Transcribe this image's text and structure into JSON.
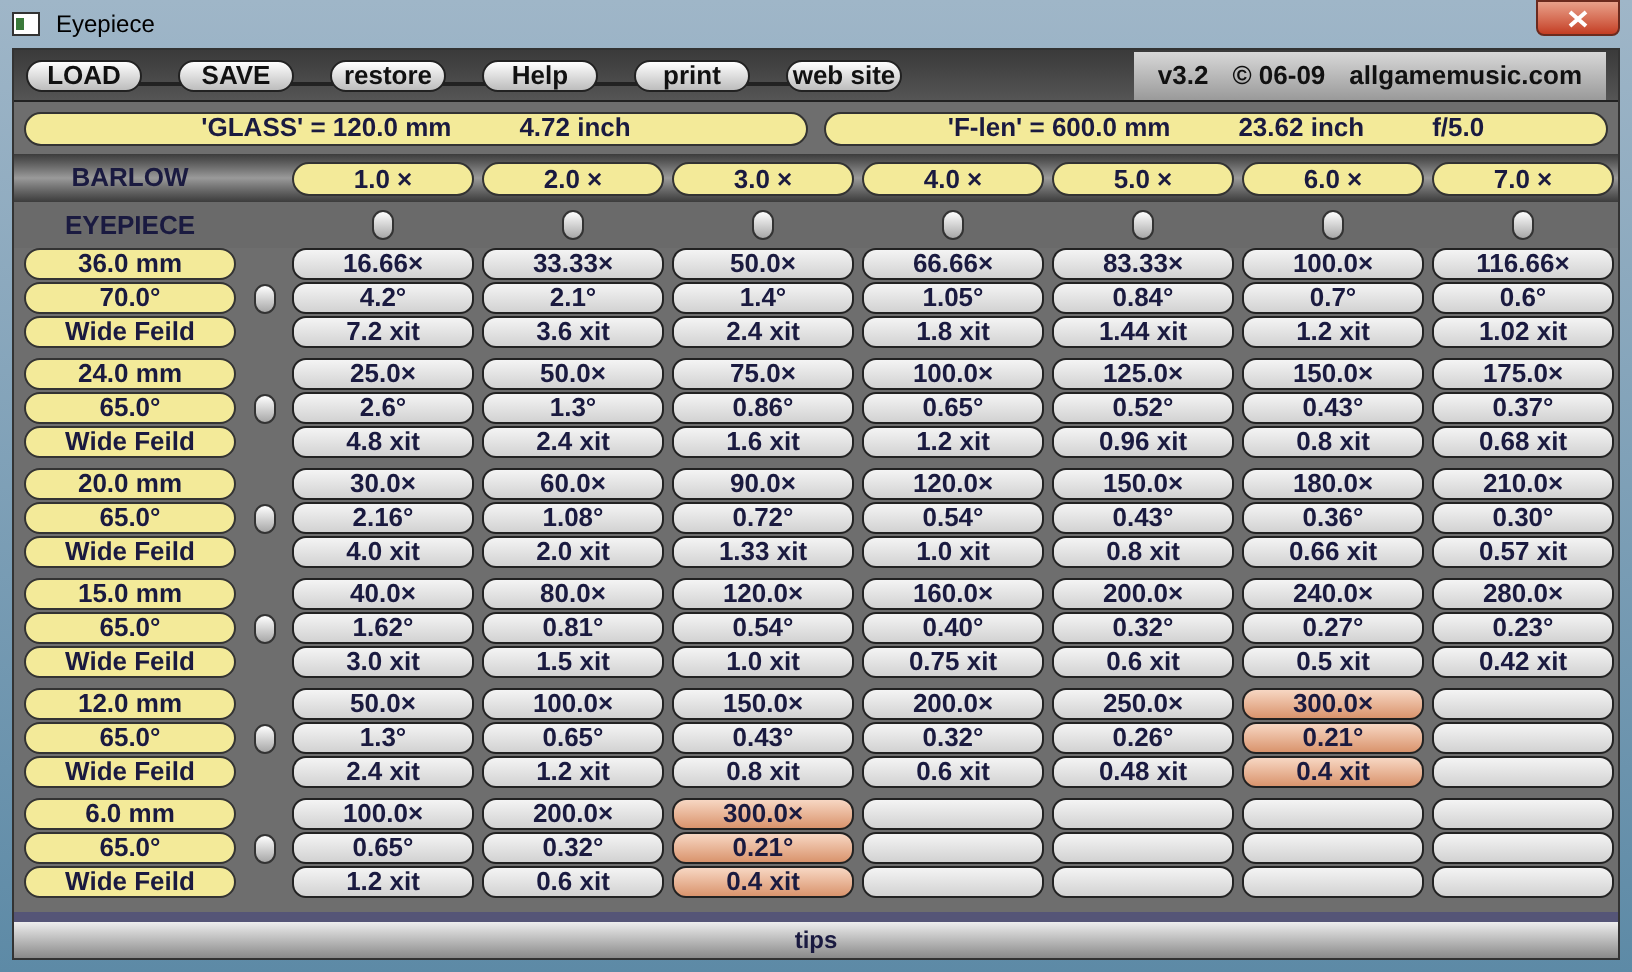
{
  "window": {
    "title": "Eyepiece"
  },
  "toolbar": {
    "buttons": [
      "LOAD",
      "SAVE",
      "restore",
      "Help",
      "print",
      "web site"
    ],
    "version": "v3.2",
    "copyright": "© 06-09",
    "site": "allgamemusic.com"
  },
  "glass": {
    "label": "'GLASS' =  120.0 mm",
    "inch": "4.72 inch"
  },
  "focal": {
    "label": "'F-len' =  600.0 mm",
    "inch": "23.62 inch",
    "ratio": "f/5.0"
  },
  "barlow": {
    "label": "BARLOW",
    "columns": [
      {
        "label": "1.0 ×",
        "selected": false
      },
      {
        "label": "2.0 ×",
        "selected": false
      },
      {
        "label": "3.0 ×",
        "selected": false
      },
      {
        "label": "4.0 ×",
        "selected": false
      },
      {
        "label": "5.0 ×",
        "selected": false
      },
      {
        "label": "6.0 ×",
        "selected": false
      },
      {
        "label": "7.0 ×",
        "selected": false
      }
    ]
  },
  "eyepiece_label": "EYEPIECE",
  "eyepieces": [
    {
      "focal": "36.0 mm",
      "fov": "70.0°",
      "type": "Wide Feild",
      "selected": false,
      "cells": [
        {
          "kind": "value",
          "mag": "16.66×",
          "field": "4.2°",
          "exit": "7.2 xit",
          "highlighted": false
        },
        {
          "kind": "value",
          "mag": "33.33×",
          "field": "2.1°",
          "exit": "3.6 xit",
          "highlighted": false
        },
        {
          "kind": "value",
          "mag": "50.0×",
          "field": "1.4°",
          "exit": "2.4 xit",
          "highlighted": false
        },
        {
          "kind": "value",
          "mag": "66.66×",
          "field": "1.05°",
          "exit": "1.8 xit",
          "highlighted": false
        },
        {
          "kind": "value",
          "mag": "83.33×",
          "field": "0.84°",
          "exit": "1.44 xit",
          "highlighted": false
        },
        {
          "kind": "value",
          "mag": "100.0×",
          "field": "0.7°",
          "exit": "1.2 xit",
          "highlighted": false
        },
        {
          "kind": "value",
          "mag": "116.66×",
          "field": "0.6°",
          "exit": "1.02 xit",
          "highlighted": false
        }
      ]
    },
    {
      "focal": "24.0 mm",
      "fov": "65.0°",
      "type": "Wide Feild",
      "selected": false,
      "cells": [
        {
          "kind": "value",
          "mag": "25.0×",
          "field": "2.6°",
          "exit": "4.8 xit",
          "highlighted": false
        },
        {
          "kind": "value",
          "mag": "50.0×",
          "field": "1.3°",
          "exit": "2.4 xit",
          "highlighted": false
        },
        {
          "kind": "value",
          "mag": "75.0×",
          "field": "0.86°",
          "exit": "1.6 xit",
          "highlighted": false
        },
        {
          "kind": "value",
          "mag": "100.0×",
          "field": "0.65°",
          "exit": "1.2 xit",
          "highlighted": false
        },
        {
          "kind": "value",
          "mag": "125.0×",
          "field": "0.52°",
          "exit": "0.96 xit",
          "highlighted": false
        },
        {
          "kind": "value",
          "mag": "150.0×",
          "field": "0.43°",
          "exit": "0.8 xit",
          "highlighted": false
        },
        {
          "kind": "value",
          "mag": "175.0×",
          "field": "0.37°",
          "exit": "0.68 xit",
          "highlighted": false
        }
      ]
    },
    {
      "focal": "20.0 mm",
      "fov": "65.0°",
      "type": "Wide Feild",
      "selected": false,
      "cells": [
        {
          "kind": "value",
          "mag": "30.0×",
          "field": "2.16°",
          "exit": "4.0 xit",
          "highlighted": false
        },
        {
          "kind": "value",
          "mag": "60.0×",
          "field": "1.08°",
          "exit": "2.0 xit",
          "highlighted": false
        },
        {
          "kind": "value",
          "mag": "90.0×",
          "field": "0.72°",
          "exit": "1.33 xit",
          "highlighted": false
        },
        {
          "kind": "value",
          "mag": "120.0×",
          "field": "0.54°",
          "exit": "1.0 xit",
          "highlighted": false
        },
        {
          "kind": "value",
          "mag": "150.0×",
          "field": "0.43°",
          "exit": "0.8 xit",
          "highlighted": false
        },
        {
          "kind": "value",
          "mag": "180.0×",
          "field": "0.36°",
          "exit": "0.66 xit",
          "highlighted": false
        },
        {
          "kind": "value",
          "mag": "210.0×",
          "field": "0.30°",
          "exit": "0.57 xit",
          "highlighted": false
        }
      ]
    },
    {
      "focal": "15.0 mm",
      "fov": "65.0°",
      "type": "Wide Feild",
      "selected": false,
      "cells": [
        {
          "kind": "value",
          "mag": "40.0×",
          "field": "1.62°",
          "exit": "3.0 xit",
          "highlighted": false
        },
        {
          "kind": "value",
          "mag": "80.0×",
          "field": "0.81°",
          "exit": "1.5 xit",
          "highlighted": false
        },
        {
          "kind": "value",
          "mag": "120.0×",
          "field": "0.54°",
          "exit": "1.0 xit",
          "highlighted": false
        },
        {
          "kind": "value",
          "mag": "160.0×",
          "field": "0.40°",
          "exit": "0.75 xit",
          "highlighted": false
        },
        {
          "kind": "value",
          "mag": "200.0×",
          "field": "0.32°",
          "exit": "0.6 xit",
          "highlighted": false
        },
        {
          "kind": "value",
          "mag": "240.0×",
          "field": "0.27°",
          "exit": "0.5 xit",
          "highlighted": false
        },
        {
          "kind": "value",
          "mag": "280.0×",
          "field": "0.23°",
          "exit": "0.42 xit",
          "highlighted": false
        }
      ]
    },
    {
      "focal": "12.0 mm",
      "fov": "65.0°",
      "type": "Wide Feild",
      "selected": false,
      "cells": [
        {
          "kind": "value",
          "mag": "50.0×",
          "field": "1.3°",
          "exit": "2.4 xit",
          "highlighted": false
        },
        {
          "kind": "value",
          "mag": "100.0×",
          "field": "0.65°",
          "exit": "1.2 xit",
          "highlighted": false
        },
        {
          "kind": "value",
          "mag": "150.0×",
          "field": "0.43°",
          "exit": "0.8 xit",
          "highlighted": false
        },
        {
          "kind": "value",
          "mag": "200.0×",
          "field": "0.32°",
          "exit": "0.6 xit",
          "highlighted": false
        },
        {
          "kind": "value",
          "mag": "250.0×",
          "field": "0.26°",
          "exit": "0.48 xit",
          "highlighted": false
        },
        {
          "kind": "value",
          "mag": "300.0×",
          "field": "0.21°",
          "exit": "0.4 xit",
          "highlighted": true
        },
        {
          "kind": "blank"
        }
      ]
    },
    {
      "focal": "6.0 mm",
      "fov": "65.0°",
      "type": "Wide Feild",
      "selected": false,
      "cells": [
        {
          "kind": "value",
          "mag": "100.0×",
          "field": "0.65°",
          "exit": "1.2 xit",
          "highlighted": false
        },
        {
          "kind": "value",
          "mag": "200.0×",
          "field": "0.32°",
          "exit": "0.6 xit",
          "highlighted": false
        },
        {
          "kind": "value",
          "mag": "300.0×",
          "field": "0.21°",
          "exit": "0.4 xit",
          "highlighted": true
        },
        {
          "kind": "blank"
        },
        {
          "kind": "blank"
        },
        {
          "kind": "blank"
        },
        {
          "kind": "blank"
        }
      ]
    }
  ],
  "status_bar": {
    "text": "tips"
  }
}
